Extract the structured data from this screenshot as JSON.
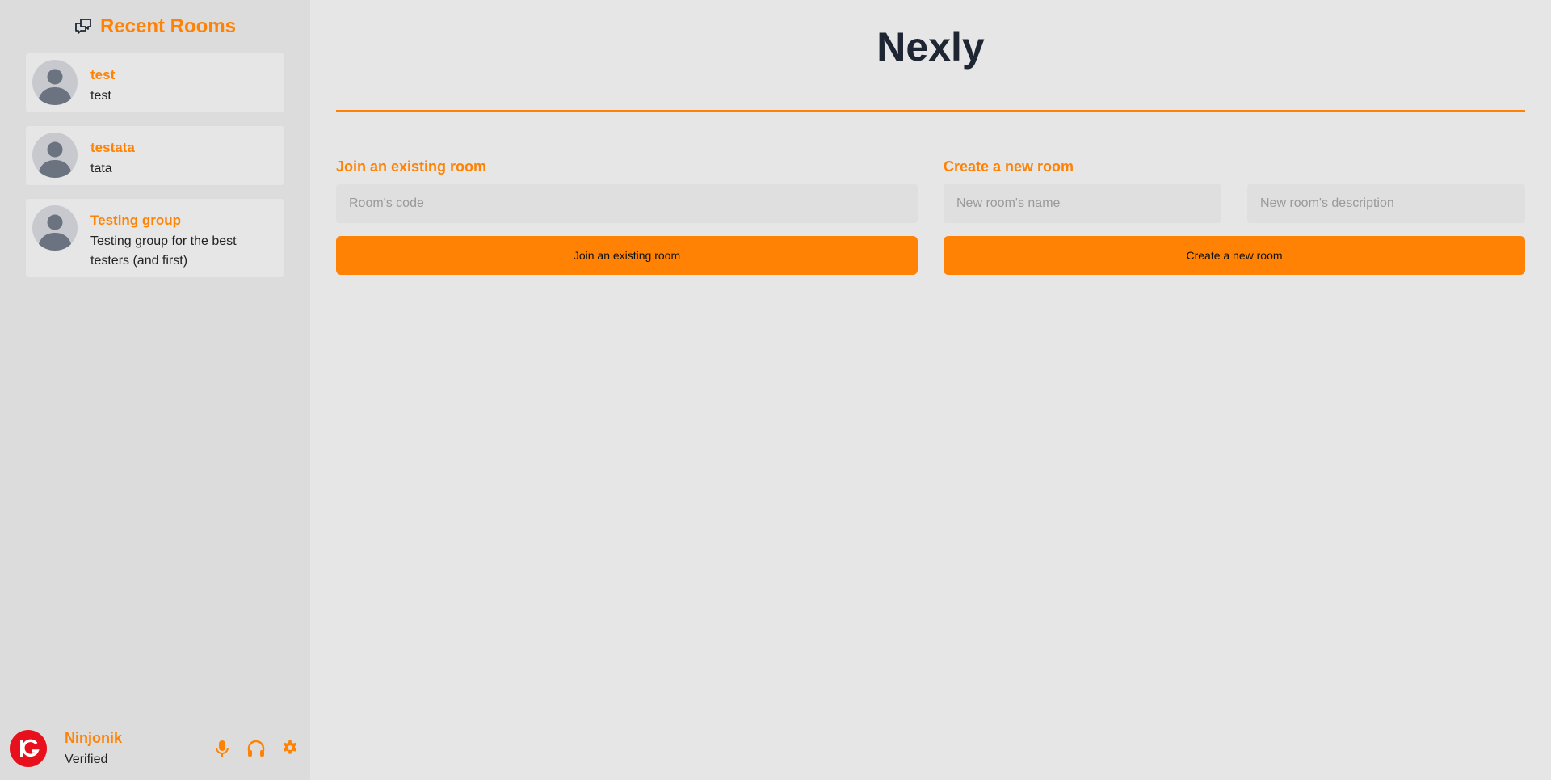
{
  "sidebar": {
    "title": "Recent Rooms",
    "header_icon": "chat-bubbles-icon",
    "rooms": [
      {
        "name": "test",
        "description": "test"
      },
      {
        "name": "testata",
        "description": "tata"
      },
      {
        "name": "Testing group",
        "description": "Testing group for the best testers (and first)"
      }
    ]
  },
  "user": {
    "name": "Ninjonik",
    "status": "Verified",
    "avatar_icon": "ig-logo-icon",
    "controls": [
      "microphone-icon",
      "headphones-icon",
      "gear-icon"
    ]
  },
  "main": {
    "title": "Nexly",
    "join": {
      "heading": "Join an existing room",
      "code_placeholder": "Room's code",
      "button_label": "Join an existing room"
    },
    "create": {
      "heading": "Create a new room",
      "name_placeholder": "New room's name",
      "description_placeholder": "New room's description",
      "button_label": "Create a new room"
    }
  },
  "colors": {
    "accent": "#ff8204",
    "sidebar_bg": "#dcdcdc",
    "main_bg": "#e6e6e6",
    "title_text": "#1f2633",
    "avatar_red": "#e8101c"
  }
}
